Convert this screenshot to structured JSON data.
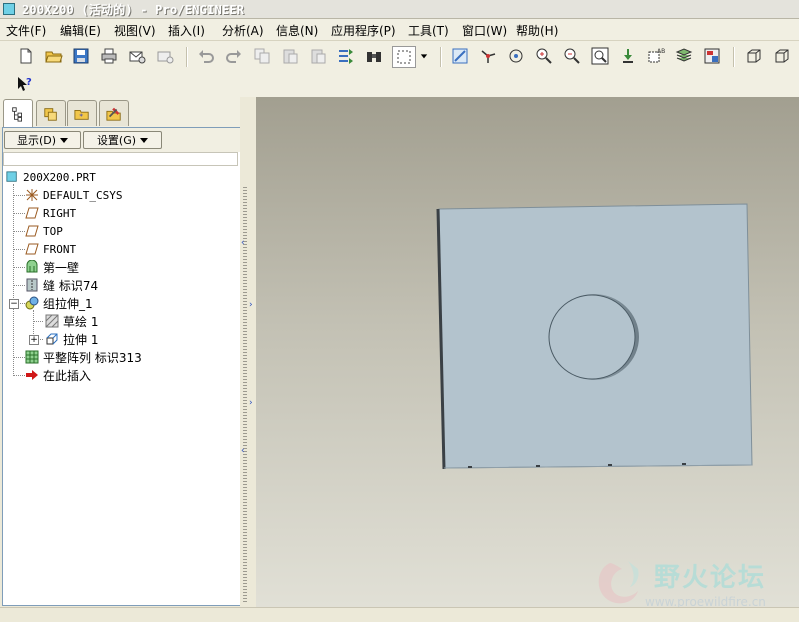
{
  "window": {
    "title": "200X200 (活动的) - Pro/ENGINEER"
  },
  "menu": [
    "文件(F)",
    "编辑(E)",
    "视图(V)",
    "插入(I)",
    "分析(A)",
    "信息(N)",
    "应用程序(P)",
    "工具(T)",
    "窗口(W)",
    "帮助(H)"
  ],
  "panel": {
    "show_label": "显示(D)",
    "settings_label": "设置(G)"
  },
  "tree": {
    "root": "200X200.PRT",
    "items": [
      {
        "label": "DEFAULT_CSYS",
        "icon": "csys-icon"
      },
      {
        "label": "RIGHT",
        "icon": "datum-plane-icon"
      },
      {
        "label": "TOP",
        "icon": "datum-plane-icon"
      },
      {
        "label": "FRONT",
        "icon": "datum-plane-icon"
      },
      {
        "label": "第一壁",
        "icon": "sheetmetal-wall-icon"
      },
      {
        "label": "缝 标识74",
        "icon": "rip-icon"
      },
      {
        "label": "组拉伸_1",
        "icon": "group-icon"
      },
      {
        "label": "草绘 1",
        "icon": "sketch-icon"
      },
      {
        "label": "拉伸 1",
        "icon": "extrude-icon"
      },
      {
        "label": "平整阵列 标识313",
        "icon": "flat-pattern-icon"
      },
      {
        "label": "在此插入",
        "icon": "insert-here-arrow-icon"
      }
    ]
  },
  "watermark": {
    "cn": "野火论坛",
    "url": "www.proewildfire.cn"
  },
  "colors": {
    "part": "#b3c3cd",
    "part_edge": "#3a4045",
    "viewport_top": "#a29f90",
    "viewport_bottom": "#e1e0d6"
  }
}
